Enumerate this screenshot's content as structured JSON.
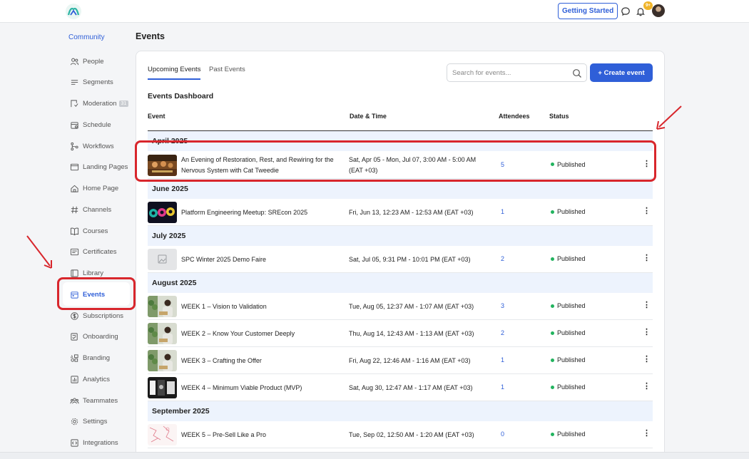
{
  "app": {
    "logo_label": "Ally",
    "getting_started": "Getting Started",
    "notification_count": "9+"
  },
  "sidebar": {
    "section": "Community",
    "items": [
      {
        "label": "People",
        "icon": "people-icon"
      },
      {
        "label": "Segments",
        "icon": "segments-icon"
      },
      {
        "label": "Moderation",
        "icon": "moderation-icon",
        "badge": "31"
      },
      {
        "label": "Schedule",
        "icon": "schedule-icon"
      },
      {
        "label": "Workflows",
        "icon": "workflows-icon"
      },
      {
        "label": "Landing Pages",
        "icon": "landing-pages-icon"
      },
      {
        "label": "Home Page",
        "icon": "home-icon"
      },
      {
        "label": "Channels",
        "icon": "hash-icon"
      },
      {
        "label": "Courses",
        "icon": "book-icon"
      },
      {
        "label": "Certificates",
        "icon": "certificate-icon"
      },
      {
        "label": "Library",
        "icon": "library-icon"
      },
      {
        "label": "Events",
        "icon": "calendar-icon",
        "active": true
      },
      {
        "label": "Subscriptions",
        "icon": "dollar-icon"
      },
      {
        "label": "Onboarding",
        "icon": "onboarding-icon"
      },
      {
        "label": "Branding",
        "icon": "branding-icon"
      },
      {
        "label": "Analytics",
        "icon": "analytics-icon"
      },
      {
        "label": "Teammates",
        "icon": "teammates-icon"
      },
      {
        "label": "Settings",
        "icon": "gear-icon"
      },
      {
        "label": "Integrations",
        "icon": "integrations-icon"
      }
    ]
  },
  "page": {
    "title": "Events",
    "tabs": [
      "Upcoming Events",
      "Past Events"
    ],
    "search_placeholder": "Search for events...",
    "create_button": "+ Create event",
    "dashboard_title": "Events Dashboard",
    "columns": {
      "event": "Event",
      "date": "Date & Time",
      "attendees": "Attendees",
      "status": "Status"
    }
  },
  "groups": [
    {
      "month": "April 2025",
      "events": [
        {
          "name": "An Evening of Restoration, Rest, and Rewiring for the Nervous System with Cat Tweedie",
          "date": "Sat, Apr 05 - Mon, Jul 07, 3:00 AM - 5:00 AM (EAT +03)",
          "attendees": "5",
          "status": "Published",
          "thumb": "warm"
        }
      ]
    },
    {
      "month": "June 2025",
      "events": [
        {
          "name": "Platform Engineering Meetup: SREcon 2025",
          "date": "Fri, Jun 13, 12:23 AM - 12:53 AM (EAT +03)",
          "attendees": "1",
          "status": "Published",
          "thumb": "dark"
        }
      ]
    },
    {
      "month": "July 2025",
      "events": [
        {
          "name": "SPC Winter 2025 Demo Faire",
          "date": "Sat, Jul 05, 9:31 PM - 10:01 PM (EAT +03)",
          "attendees": "2",
          "status": "Published",
          "thumb": "placeholder"
        }
      ]
    },
    {
      "month": "August 2025",
      "events": [
        {
          "name": "WEEK 1 – Vision to Validation",
          "date": "Tue, Aug 05, 12:37 AM - 1:07 AM (EAT +03)",
          "attendees": "3",
          "status": "Published",
          "thumb": "person"
        },
        {
          "name": "WEEK 2 – Know Your Customer Deeply",
          "date": "Thu, Aug 14, 12:43 AM - 1:13 AM (EAT +03)",
          "attendees": "2",
          "status": "Published",
          "thumb": "person"
        },
        {
          "name": "WEEK 3 – Crafting the Offer",
          "date": "Fri, Aug 22, 12:46 AM - 1:16 AM (EAT +03)",
          "attendees": "1",
          "status": "Published",
          "thumb": "person"
        },
        {
          "name": "WEEK 4 – Minimum Viable Product (MVP)",
          "date": "Sat, Aug 30, 12:47 AM - 1:17 AM (EAT +03)",
          "attendees": "1",
          "status": "Published",
          "thumb": "mono"
        }
      ]
    },
    {
      "month": "September 2025",
      "events": [
        {
          "name": "WEEK 5 – Pre-Sell Like a Pro",
          "date": "Tue, Sep 02, 12:50 AM - 1:20 AM (EAT +03)",
          "attendees": "0",
          "status": "Published",
          "thumb": "sketch"
        }
      ]
    }
  ],
  "colors": {
    "accent": "#2f5fd8",
    "highlight": "#d8262c",
    "published": "#22b35e",
    "month_bg": "#edf3fd"
  }
}
